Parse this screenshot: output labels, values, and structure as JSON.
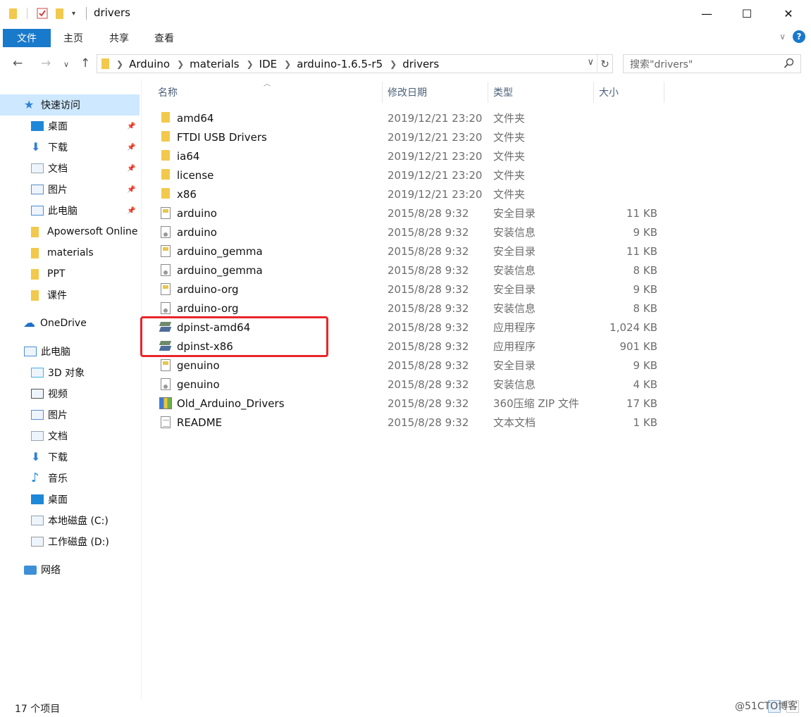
{
  "window": {
    "title": "drivers",
    "controls": {
      "minimize": "—",
      "maximize": "☐",
      "close": "✕"
    }
  },
  "ribbon": {
    "file_tab": "文件",
    "tabs": [
      "主页",
      "共享",
      "查看"
    ]
  },
  "address": {
    "crumbs": [
      "Arduino",
      "materials",
      "IDE",
      "arduino-1.6.5-r5",
      "drivers"
    ],
    "search_placeholder": "搜索\"drivers\""
  },
  "sidebar": {
    "quick_access": "快速访问",
    "quick_items": [
      {
        "label": "桌面",
        "icon": "desktop-icon",
        "pinned": true
      },
      {
        "label": "下载",
        "icon": "download-icon",
        "pinned": true
      },
      {
        "label": "文档",
        "icon": "documents-icon",
        "pinned": true
      },
      {
        "label": "图片",
        "icon": "pictures-icon",
        "pinned": true
      },
      {
        "label": "此电脑",
        "icon": "computer-icon",
        "pinned": true
      },
      {
        "label": "Apowersoft Online",
        "icon": "folder-icon",
        "pinned": false
      },
      {
        "label": "materials",
        "icon": "folder-icon",
        "pinned": false
      },
      {
        "label": "PPT",
        "icon": "folder-icon",
        "pinned": false
      },
      {
        "label": "课件",
        "icon": "folder-icon",
        "pinned": false
      }
    ],
    "onedrive": "OneDrive",
    "this_pc": "此电脑",
    "pc_items": [
      {
        "label": "3D 对象",
        "icon": "3d-objects-icon"
      },
      {
        "label": "视频",
        "icon": "video-icon"
      },
      {
        "label": "图片",
        "icon": "pictures-icon"
      },
      {
        "label": "文档",
        "icon": "documents-icon"
      },
      {
        "label": "下载",
        "icon": "download-icon"
      },
      {
        "label": "音乐",
        "icon": "music-icon"
      },
      {
        "label": "桌面",
        "icon": "desktop-icon"
      },
      {
        "label": "本地磁盘 (C:)",
        "icon": "drive-c-icon"
      },
      {
        "label": "工作磁盘 (D:)",
        "icon": "drive-d-icon"
      }
    ],
    "network": "网络"
  },
  "columns": {
    "name": "名称",
    "date": "修改日期",
    "type": "类型",
    "size": "大小"
  },
  "files": [
    {
      "name": "amd64",
      "date": "2019/12/21 23:20",
      "type": "文件夹",
      "size": "",
      "icon": "folder"
    },
    {
      "name": "FTDI USB Drivers",
      "date": "2019/12/21 23:20",
      "type": "文件夹",
      "size": "",
      "icon": "folder"
    },
    {
      "name": "ia64",
      "date": "2019/12/21 23:20",
      "type": "文件夹",
      "size": "",
      "icon": "folder"
    },
    {
      "name": "license",
      "date": "2019/12/21 23:20",
      "type": "文件夹",
      "size": "",
      "icon": "folder"
    },
    {
      "name": "x86",
      "date": "2019/12/21 23:20",
      "type": "文件夹",
      "size": "",
      "icon": "folder"
    },
    {
      "name": "arduino",
      "date": "2015/8/28 9:32",
      "type": "安全目录",
      "size": "11 KB",
      "icon": "cat"
    },
    {
      "name": "arduino",
      "date": "2015/8/28 9:32",
      "type": "安装信息",
      "size": "9 KB",
      "icon": "inf"
    },
    {
      "name": "arduino_gemma",
      "date": "2015/8/28 9:32",
      "type": "安全目录",
      "size": "11 KB",
      "icon": "cat"
    },
    {
      "name": "arduino_gemma",
      "date": "2015/8/28 9:32",
      "type": "安装信息",
      "size": "8 KB",
      "icon": "inf"
    },
    {
      "name": "arduino-org",
      "date": "2015/8/28 9:32",
      "type": "安全目录",
      "size": "9 KB",
      "icon": "cat"
    },
    {
      "name": "arduino-org",
      "date": "2015/8/28 9:32",
      "type": "安装信息",
      "size": "8 KB",
      "icon": "inf"
    },
    {
      "name": "dpinst-amd64",
      "date": "2015/8/28 9:32",
      "type": "应用程序",
      "size": "1,024 KB",
      "icon": "exe"
    },
    {
      "name": "dpinst-x86",
      "date": "2015/8/28 9:32",
      "type": "应用程序",
      "size": "901 KB",
      "icon": "exe"
    },
    {
      "name": "genuino",
      "date": "2015/8/28 9:32",
      "type": "安全目录",
      "size": "9 KB",
      "icon": "cat"
    },
    {
      "name": "genuino",
      "date": "2015/8/28 9:32",
      "type": "安装信息",
      "size": "4 KB",
      "icon": "inf"
    },
    {
      "name": "Old_Arduino_Drivers",
      "date": "2015/8/28 9:32",
      "type": "360压缩 ZIP 文件",
      "size": "17 KB",
      "icon": "zip"
    },
    {
      "name": "README",
      "date": "2015/8/28 9:32",
      "type": "文本文档",
      "size": "1 KB",
      "icon": "txt"
    }
  ],
  "status": {
    "count": "17 个项目"
  },
  "watermark": "@51CTO博客",
  "colors": {
    "accent": "#1979ca",
    "selected": "#cde8ff",
    "highlight_border": "#e8262a"
  }
}
